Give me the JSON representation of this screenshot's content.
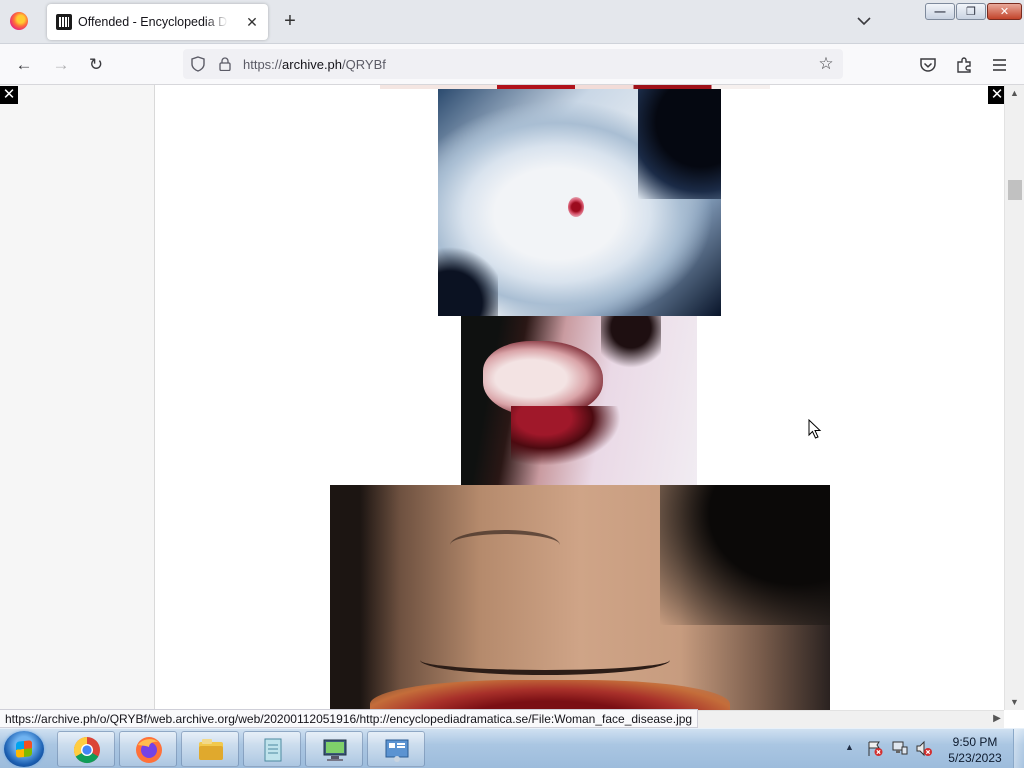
{
  "browser": {
    "tab": {
      "title": "Offended - Encyclopedia Dramatica",
      "close_glyph": "✕"
    },
    "new_tab_glyph": "+",
    "window_controls": {
      "minimize": "—",
      "maximize": "❐",
      "close": "✕"
    },
    "nav": {
      "back_glyph": "←",
      "forward_glyph": "→",
      "reload_glyph": "↻"
    },
    "url": {
      "scheme": "https://",
      "host": "archive.ph",
      "path": "/QRYBf"
    },
    "bookmark_glyph": "☆"
  },
  "page": {
    "overlay_close_glyph": "✕",
    "images": [
      {
        "name": "image-bruised-skin",
        "interactable": true
      },
      {
        "name": "image-injured-face",
        "interactable": true
      },
      {
        "name": "image-woman-face-disease",
        "interactable": true
      }
    ]
  },
  "status_bar": {
    "link_url": "https://archive.ph/o/QRYBf/web.archive.org/web/20200112051916/http://encyclopediadramatica.se/File:Woman_face_disease.jpg"
  },
  "scrollbar": {
    "up_glyph": "▲",
    "down_glyph": "▼",
    "right_glyph": "▶"
  },
  "taskbar": {
    "pinned": [
      "chrome-icon",
      "firefox-icon",
      "file-explorer-icon",
      "notepad-icon",
      "remote-desktop-icon",
      "control-panel-icon"
    ],
    "tray_arrow_glyph": "▲",
    "clock": {
      "time": "9:50 PM",
      "date": "5/23/2023"
    }
  }
}
